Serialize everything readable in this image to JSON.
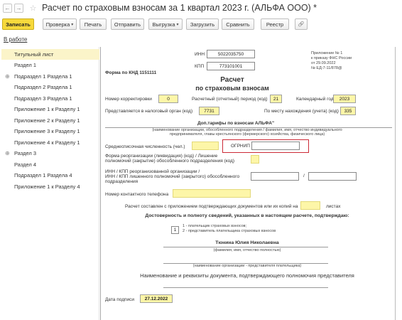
{
  "window": {
    "title": "Расчет по страховым взносам за 1 квартал 2023 г. (АЛЬФА ООО) *",
    "back_icon": "←",
    "forward_icon": "→",
    "star_icon": "☆"
  },
  "toolbar": {
    "save": "Записать",
    "check": "Проверка",
    "print": "Печать",
    "send": "Отправить",
    "export": "Выгрузка",
    "load": "Загрузить",
    "compare": "Сравнить",
    "registry": "Реестр",
    "caret": "▾",
    "attach_icon": "🔗"
  },
  "link": {
    "in_work": "В работе"
  },
  "tree": {
    "items": [
      {
        "label": "Титульный лист",
        "expandable": false
      },
      {
        "label": "Раздел 1",
        "expandable": false
      },
      {
        "label": "Подраздел 1 Раздела 1",
        "expandable": true
      },
      {
        "label": "Подраздел 2 Раздела 1",
        "expandable": false
      },
      {
        "label": "Подраздел 3 Раздела 1",
        "expandable": false
      },
      {
        "label": "Приложение 1 к Разделу 1",
        "expandable": false
      },
      {
        "label": "Приложение 2 к Разделу 1",
        "expandable": false
      },
      {
        "label": "Приложение 3 к Разделу 1",
        "expandable": false
      },
      {
        "label": "Приложение 4 к Разделу 1",
        "expandable": false
      },
      {
        "label": "Раздел 3",
        "expandable": true
      },
      {
        "label": "Раздел 4",
        "expandable": false
      },
      {
        "label": "Подраздел 1 Раздела 4",
        "expandable": false
      },
      {
        "label": "Приложение 1 к Разделу 4",
        "expandable": false
      }
    ],
    "plus": "⊕"
  },
  "form": {
    "inn_label": "ИНН",
    "inn_value": "5022035750",
    "kpp_label": "КПП",
    "kpp_value": "773101001",
    "appendix_line1": "Приложение № 1",
    "appendix_line2": "к приказу ФНС России",
    "appendix_line3": "от 29.09.2022",
    "appendix_line4": "№ ЕД-7-11/878@",
    "knd": "Форма по КНД 1151111",
    "title1": "Расчет",
    "title2": "по страховым взносам",
    "correction_label": "Номер корректировки",
    "correction_value": "0",
    "period_label": "Расчетный (отчетный) период (код)",
    "period_value": "21",
    "year_label": "Календарный год",
    "year_value": "2023",
    "tax_org_label": "Представляется в налоговый орган (код)",
    "tax_org_value": "7731",
    "location_label": "По месту нахождения (учета) (код)",
    "location_value": "335",
    "org_name": "Доп.тарифы по взносам АЛЬФА\"",
    "org_caption1": "(наименование организации, обособленного подразделения / фамилия, имя, отчество индивидуального",
    "org_caption2": "предпринимателя, главы крестьянского (фермерского) хозяйства, физического лица)",
    "headcount_label": "Среднесписочная численность (чел.)",
    "ogrnip_label": "ОГРНИП",
    "reorg_label1": "Форма реорганизации (ликвидация) (код) / Лишение",
    "reorg_label2": "полномочий (закрытие) обособленного подразделения (код)",
    "reorg_inn_label1": "ИНН / КПП реорганизованной организации /",
    "reorg_inn_label2": "ИНН / КПП лишенного полномочий (закрытого) обособленного",
    "reorg_inn_label3": "подразделения",
    "slash": "/",
    "phone_label": "Номер контактного телефона",
    "pages_label": "Расчет составлен с приложением подтверждающих документов или их копий на",
    "pages_suffix": "листах",
    "confirm_heading": "Достоверность и полноту сведений, указанных в настоящем расчете, подтверждаю:",
    "signer_value": "1",
    "signer_opt1": "1 - плательщик страховых взносов;",
    "signer_opt2": "2 - представитель плательщика страховых взносов",
    "person_name": "Тюнина Юлия Николаевна",
    "person_caption": "(фамилия, имя, отчество полностью)",
    "rep_caption": "(наименование организации - представителя плательщика)",
    "doc_heading": "Наименование и реквизиты документа, подтверждающего полномочия представителя",
    "date_label": "Дата подписи",
    "date_value": "27.12.2022"
  }
}
